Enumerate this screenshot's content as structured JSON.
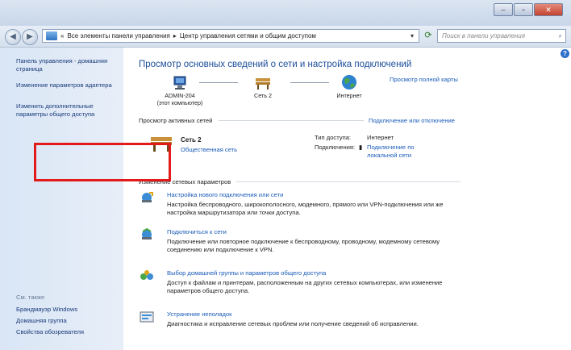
{
  "window": {
    "buttons": {
      "minimize": "–",
      "maximize": "▫",
      "close": "✕"
    }
  },
  "address_bar": {
    "prefix": "«",
    "crumb1": "Все элементы панели управления",
    "sep": "▸",
    "crumb2": "Центр управления сетями и общим доступом",
    "search_placeholder": "Поиск в панели управления"
  },
  "left_nav": {
    "items": [
      "Панель управления - домашняя страница",
      "Изменение параметров адаптера",
      "Изменить дополнительные параметры общего доступа"
    ],
    "see_also_title": "См. также",
    "see_also": [
      "Брандмауэр Windows",
      "Домашняя группа",
      "Свойства обозревателя"
    ]
  },
  "main": {
    "title": "Просмотр основных сведений о сети и настройка подключений",
    "full_map_link": "Просмотр полной карты",
    "map": {
      "computer": "ADMIN-204",
      "computer_sub": "(этот компьютер)",
      "network": "Сеть 2",
      "internet": "Интернет"
    },
    "active_section": "Просмотр активных сетей",
    "connect_link": "Подключение или отключение",
    "active_network": {
      "name": "Сеть 2",
      "type": "Общественная сеть",
      "access_label": "Тип доступа:",
      "access_value": "Интернет",
      "connections_label": "Подключения:",
      "connections_value": "Подключение по локальной сети"
    },
    "change_section": "Изменение сетевых параметров",
    "tasks": [
      {
        "title": "Настройка нового подключения или сети",
        "desc": "Настройка беспроводного, широкополосного, модемного, прямого или VPN-подключения или же настройка маршрутизатора или точки доступа."
      },
      {
        "title": "Подключиться к сети",
        "desc": "Подключение или повторное подключение к беспроводному, проводному, модемному сетевому соединению или подключение к VPN."
      },
      {
        "title": "Выбор домашней группы и параметров общего доступа",
        "desc": "Доступ к файлам и принтерам, расположенным на других сетевых компьютерах, или изменение параметров общего доступа."
      },
      {
        "title": "Устранение неполадок",
        "desc": "Диагностика и исправление сетевых проблем или получение сведений об исправлении."
      }
    ]
  },
  "colors": {
    "link": "#1a5bb8",
    "highlight_box": "#e31a1a"
  }
}
